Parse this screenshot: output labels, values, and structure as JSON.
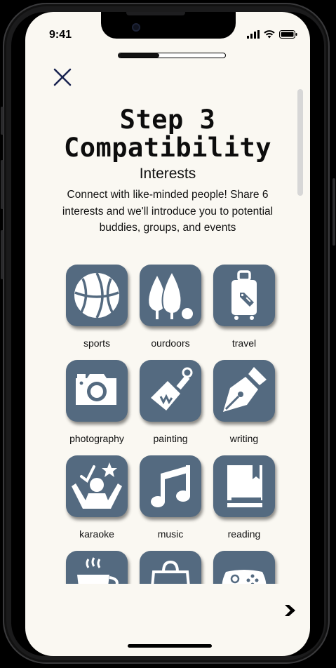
{
  "status_bar": {
    "time": "9:41",
    "icons": [
      "signal-icon",
      "wifi-icon",
      "battery-icon"
    ]
  },
  "onboarding": {
    "progress_fraction": 0.38,
    "step_title": "Step 3",
    "step_name": "Compatibility"
  },
  "header": {
    "close_icon": "close-icon"
  },
  "section": {
    "title": "Interests",
    "description": "Connect with like-minded people! Share 6 interests and we'll introduce you to potential buddies, groups, and events"
  },
  "interests": [
    {
      "label": "sports",
      "icon": "basketball-icon"
    },
    {
      "label": "ourdoors",
      "icon": "trees-icon"
    },
    {
      "label": "travel",
      "icon": "suitcase-icon"
    },
    {
      "label": "photography",
      "icon": "camera-icon"
    },
    {
      "label": "painting",
      "icon": "paintbrush-icon"
    },
    {
      "label": "writing",
      "icon": "fountain-pen-icon"
    },
    {
      "label": "karaoke",
      "icon": "singer-icon"
    },
    {
      "label": "music",
      "icon": "music-note-icon"
    },
    {
      "label": "reading",
      "icon": "book-icon"
    },
    {
      "label": "",
      "icon": "coffee-cup-icon"
    },
    {
      "label": "",
      "icon": "shopping-bag-icon"
    },
    {
      "label": "",
      "icon": "gamepad-icon"
    }
  ],
  "footer": {
    "next_icon": "chevron-right-icon"
  },
  "colors": {
    "tile": "#546a80",
    "background": "#faf8f2",
    "icon": "#ffffff"
  }
}
